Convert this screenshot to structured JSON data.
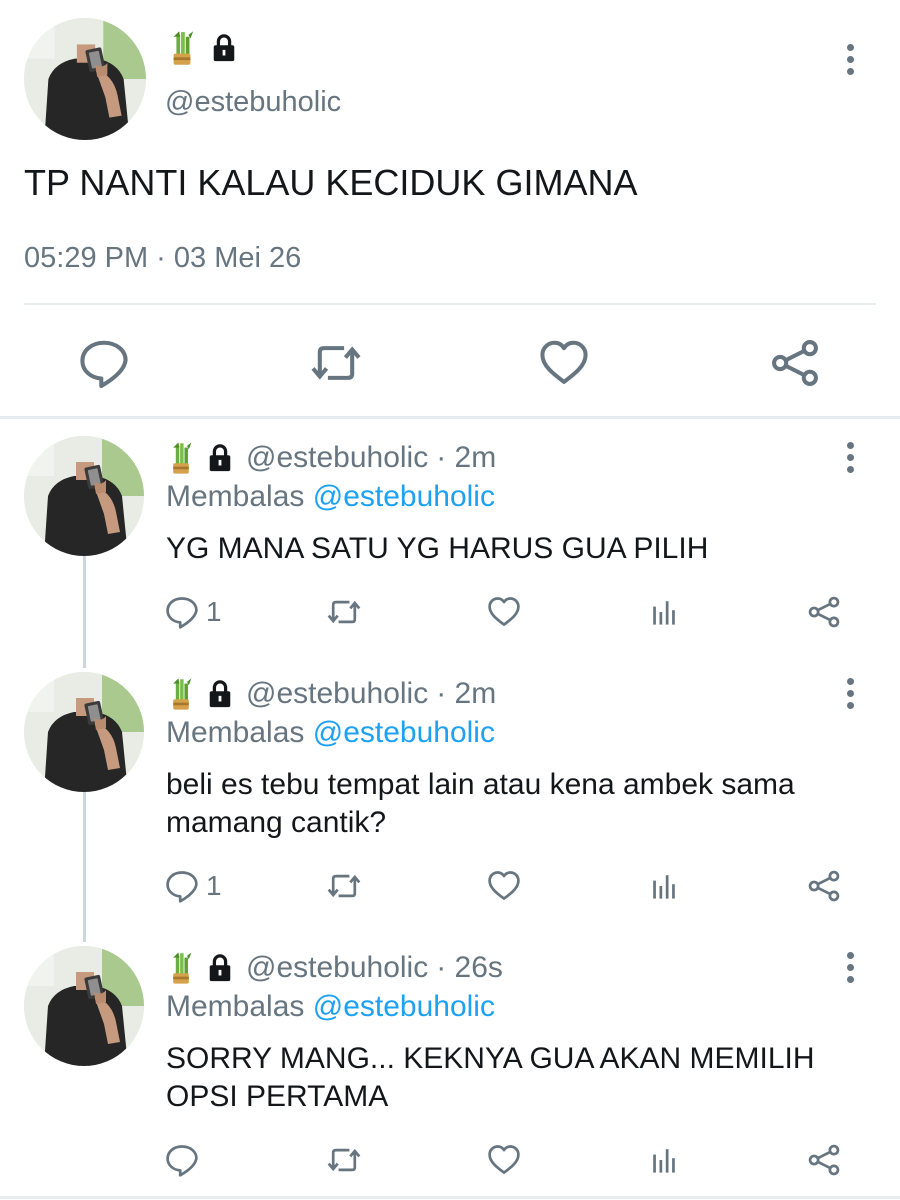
{
  "main_tweet": {
    "handle": "@estebuholic",
    "name_icons": [
      "bamboo-decoration-icon",
      "lock-icon"
    ],
    "text": "TP NANTI KALAU KECIDUK GIMANA",
    "timestamp": "05:29 PM · 03 Mei 26",
    "actions": [
      "reply-icon",
      "retweet-icon",
      "like-icon",
      "share-icon"
    ]
  },
  "replies": [
    {
      "handle": "@estebuholic",
      "time": "· 2m",
      "replying_prefix": "Membalas",
      "replying_to": "@estebuholic",
      "text": "YG MANA SATU YG HARUS GUA PILIH",
      "reply_count": "1"
    },
    {
      "handle": "@estebuholic",
      "time": "· 2m",
      "replying_prefix": "Membalas",
      "replying_to": "@estebuholic",
      "text": "beli es tebu tempat lain atau kena ambek sama mamang cantik?",
      "reply_count": "1"
    },
    {
      "handle": "@estebuholic",
      "time": "· 26s",
      "replying_prefix": "Membalas",
      "replying_to": "@estebuholic",
      "text": "SORRY MANG... KEKNYA GUA AKAN MEMILIH OPSI PERTAMA",
      "reply_count": ""
    }
  ],
  "colors": {
    "text": "#14171a",
    "secondary": "#66757f",
    "link": "#1da1f2",
    "divider": "#e6ecf0",
    "thread_line": "#ccd6dd"
  }
}
